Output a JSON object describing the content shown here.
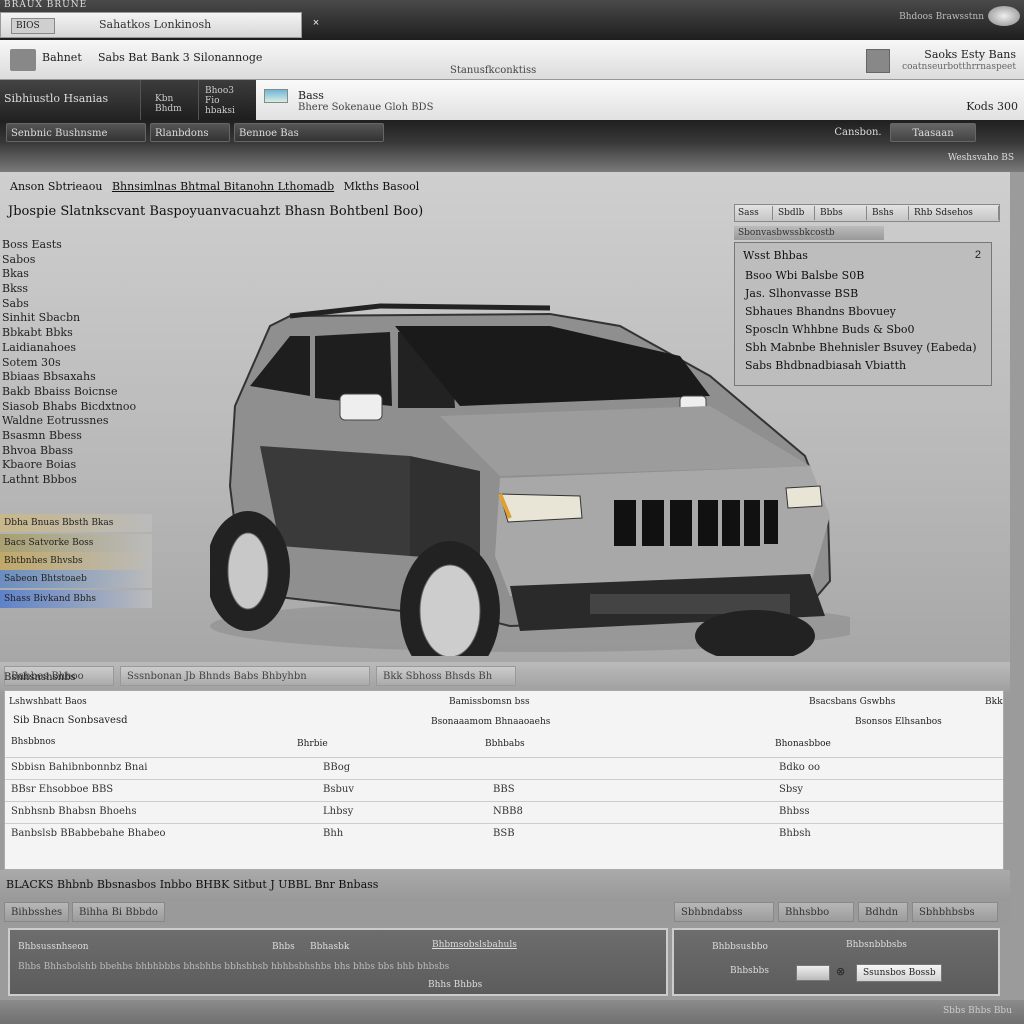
{
  "titlebar": {
    "brand": "BRAUX BRUNE",
    "address_icon": "BIOS",
    "address_text": "Sahatkos Lonkinosh",
    "close": "×",
    "right_text": "Bhdoos Brawsstnn"
  },
  "toolbar": {
    "label_1": "Bahnet",
    "label_2": "Sabs Bat Bank 3 Silonannoge",
    "center_caption": "Stanusfkconktiss",
    "right_title": "Saoks Esty Bans",
    "right_subtitle": "coatnseurbotthrrnaspeet"
  },
  "tabs": {
    "tab_a": "Sibhiustlo Hsanias",
    "tab_b": "Kbn Bhdm",
    "tab_c": "Bhoo3 Fio hbaksi",
    "active_title": "Bass",
    "active_subtitle": "Bhere Sokenaue Gloh BDS",
    "active_right": "Kods 300"
  },
  "menu": {
    "m1": "Senbnic Bushnsme",
    "m2": "Rlanbdons",
    "m3": "Bennoe Bas",
    "m4": "Cansbon.",
    "m5": "Taasaan"
  },
  "header_strip": "Weshsvaho BS",
  "breadcrumb": {
    "c1": "Anson Sbtrieaou",
    "c2": "Bhnsimlnas Bhtmal Bitanohn Lthomadb",
    "c3": "Mkths Basool"
  },
  "page_title": "Jbospie Slatnkscvant Baspoyuanvacuahzt Bhasn Bohtbenl Boo)",
  "specs": [
    "Boss   Easts",
    "Sabos",
    "  Bkas",
    "  Bkss",
    "Sabs",
    "Sinhit Sbacbn",
    "Bbkabt Bbks",
    "Laidianahoes",
    "Sotem 30s",
    "Bbiaas Bbsaxahs",
    "Bakb Bbaiss Boicnse",
    "Siasob Bhabs Bicdxtnoo",
    "Waldne Eotrussnes",
    "Bsasmn Bbess",
    "Bhvoa Bbass",
    "Kbaore Boias",
    "Lathnt Bbbos"
  ],
  "colors": [
    {
      "label": "Dbha Bnuas Bbsth Bkas",
      "color": "#c7b78a"
    },
    {
      "label": "Bacs Satvorke Boss",
      "color": "#a8a070"
    },
    {
      "label": "Bhtbnhes Bhvsbs",
      "color": "#c0a868"
    },
    {
      "label": "Sabeon Bhtstoaeb",
      "color": "#6b8dbf"
    },
    {
      "label": "Shass Bivkand Bbhs",
      "color": "#5e82c9"
    }
  ],
  "right_panel": {
    "tabs": [
      "Sass",
      "Sbdlb",
      "Bbbs",
      "Bshs",
      "Rhb Sdsehos"
    ],
    "subheader": "Sbonvasbwssbkcostb",
    "title": "Wsst Bhbas",
    "close": "2",
    "lines": [
      "Bsoo Wbi Balsbe S0B",
      "Jas. Slhonvasse BSB",
      "Sbhaues Bhandns Bbovuey",
      "Sposcln Whhbne Buds & Sbo0",
      "Sbh Mabnbe Bhehnisler Bsuvey (Eabeda)",
      "Sabs Bhdbnadbiasah Vbiatth"
    ]
  },
  "option_chips": [
    "Bahbes Bhhoo",
    "Sssnbonan Jb Bhnds Babs Bhbyhbn",
    "Bkk Sbhoss Bhsds Bh"
  ],
  "table": {
    "section_title": "Bsnhsnshsnbs",
    "title_top_mid": "Bamissbomsn bss",
    "title_top_right_1": "Bsacsbans Gswbhs",
    "title_top_right_2": "Bkk",
    "subheader_left": "Sib Bnacn Sonbsavesd",
    "subheader_mid": "Bsonaaamom Bhnaaoaehs",
    "subheader_right": "Bsonsos Elhsanbos",
    "col_headers": [
      "Lshwshbatt Baos",
      "Bhsbbnos",
      "Bhrbie",
      "Bbhbabs",
      "Bhonasbboe"
    ],
    "rows": [
      {
        "c1": "Sbbisn Bahibnbonnbz Bnai",
        "c2": "BBog",
        "c3": "",
        "c4": "Bdko oo"
      },
      {
        "c1": "BBsr Ehsobboe BBS",
        "c2": "Bsbuv",
        "c3": "BBS",
        "c4": "Sbsy"
      },
      {
        "c1": "Snbhsnb Bhabsn Bhoehs",
        "c2": "Lhbsy",
        "c3": "NBB8",
        "c4": "Bhbss"
      },
      {
        "c1": "Banbslsb BBabbebahe Bhabeo",
        "c2": "Bhh",
        "c3": "BSB",
        "c4": "Bhbsh"
      }
    ]
  },
  "summary_text": "BLACKS Bhbnb Bbsnasbos Inbbo BHBK Sitbut J UBBL Bnr Bnbass",
  "actions": [
    "Bihbsshes",
    "Bihha Bi Bbbdo",
    "Sbhbndabss",
    "Bhhsbbo",
    "Bdhdn",
    "Sbhbhbsbs"
  ],
  "bottom_left": {
    "l1": "Bhbsussnhseon",
    "l2": "Bhbs",
    "l3": "Bbhasbk",
    "l4": "Bhbmsobslsbahuls",
    "l5": "Bhbs Bhhsbolshb bbehbs bhbhbbbs bhsbhbs bbhsbbsb hbhbsbhshbs bhs bhbs bbs bhb bhbsbs",
    "l6": "Bhhs Bhbbs"
  },
  "bottom_right": {
    "l1": "Bhbbsusbbo",
    "l2": "Bhbsnbbbsbs",
    "l3": "Bhbsbbs",
    "search": "Ssunsbos Bossb",
    "toggle_glyph": "⊗"
  },
  "status_text": "Sbbs Bhbs Bbu"
}
